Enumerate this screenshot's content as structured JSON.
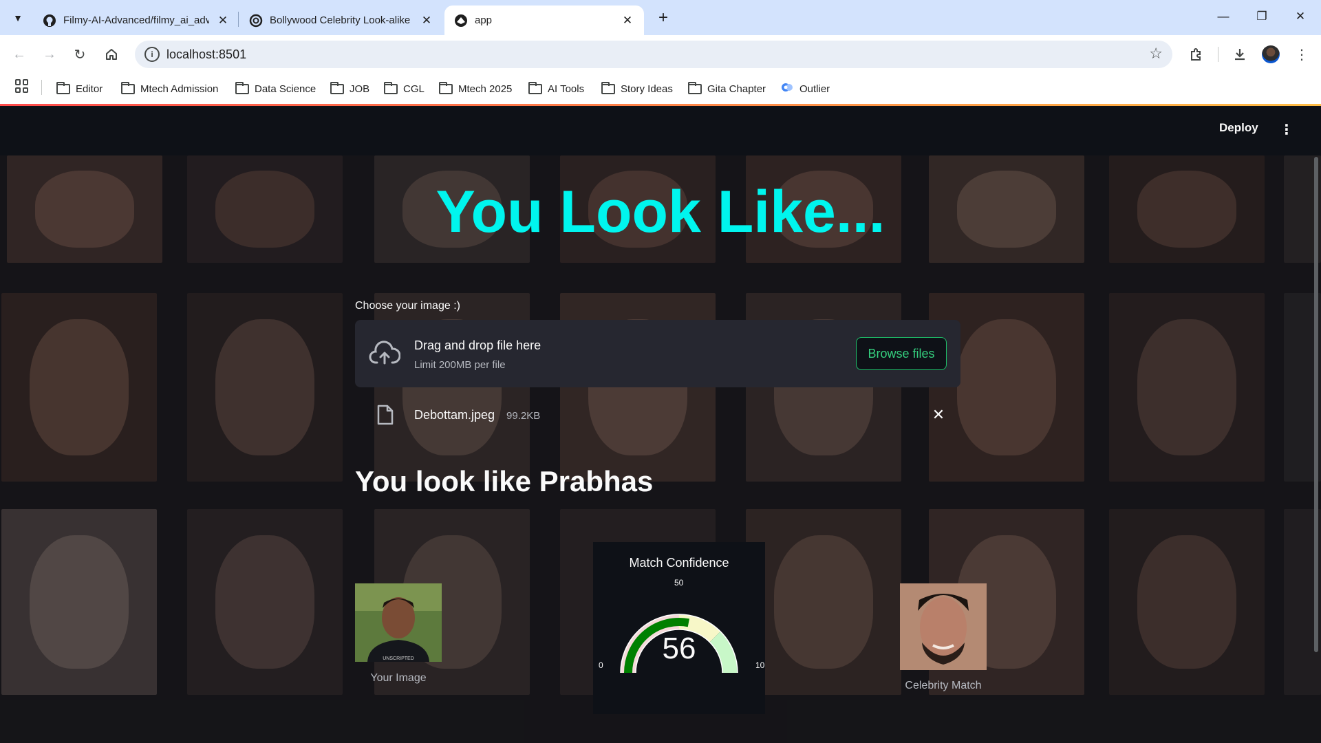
{
  "browser": {
    "tabs": [
      {
        "title": "Filmy-AI-Advanced/filmy_ai_adv",
        "favicon": "github-icon",
        "active": false
      },
      {
        "title": "Bollywood Celebrity Look-alike",
        "favicon": "openai-icon",
        "active": false
      },
      {
        "title": "app",
        "favicon": "streamlit-icon",
        "active": true
      }
    ],
    "url": "localhost:8501",
    "bookmarks": [
      "Editor",
      "Mtech Admission",
      "Data Science",
      "JOB",
      "CGL",
      "Mtech 2025",
      "AI Tools",
      "Story Ideas",
      "Gita Chapter",
      "Outlier"
    ]
  },
  "app": {
    "header": {
      "deploy_label": "Deploy",
      "menu_icon": "kebab-menu-icon"
    },
    "title": "You Look Like...",
    "uploader": {
      "label": "Choose your image :)",
      "drag_text": "Drag and drop file here",
      "limit_text": "Limit 200MB per file",
      "browse_label": "Browse files",
      "file_name": "Debottam.jpeg",
      "file_size": "99.2KB"
    },
    "result_text": "You look like Prabhas",
    "your_image_caption": "Your Image",
    "celebrity_caption": "Celebrity Match",
    "gauge": {
      "title": "Match Confidence",
      "value": "56",
      "value_num": 56,
      "tick_min": "0",
      "tick_mid": "50",
      "tick_max": "10",
      "range_min": 0,
      "range_max": 100,
      "bar_color": "#008000",
      "step_colors": [
        "#f5dada",
        "#f7f7c8",
        "#c8f7c8"
      ]
    }
  },
  "colors": {
    "accent_title": "#00f5ee",
    "browse_border": "#1fbf6a",
    "background": "#0e1117"
  }
}
